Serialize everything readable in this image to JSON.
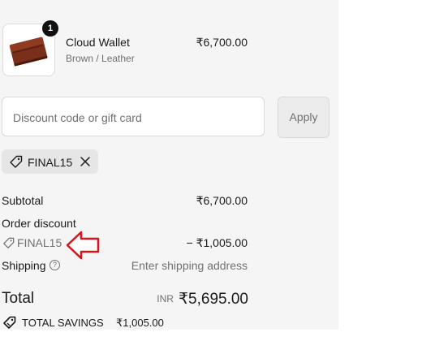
{
  "colors": {
    "annotation_arrow": "#d9131b",
    "panel_background": "#f5f5f5"
  },
  "product": {
    "image_icon": "wallet-image",
    "quantity": "1",
    "name": "Cloud Wallet",
    "variant": "Brown / Leather",
    "price": "₹6,700.00"
  },
  "discount": {
    "placeholder": "Discount code or gift card",
    "apply_label": "Apply",
    "applied_code": "FINAL15",
    "applied_icon": "tag-icon",
    "remove_icon": "close-icon"
  },
  "summary": {
    "subtotal_label": "Subtotal",
    "subtotal_value": "₹6,700.00",
    "order_discount_label": "Order discount",
    "discount_code": "FINAL15",
    "discount_value": "− ₹1,005.00",
    "shipping_label": "Shipping",
    "shipping_help_icon": "question-circle-icon",
    "shipping_value": "Enter shipping address",
    "total_label": "Total",
    "currency": "INR",
    "total_value": "₹5,695.00",
    "savings_label": "TOTAL SAVINGS",
    "savings_value": "₹1,005.00"
  }
}
